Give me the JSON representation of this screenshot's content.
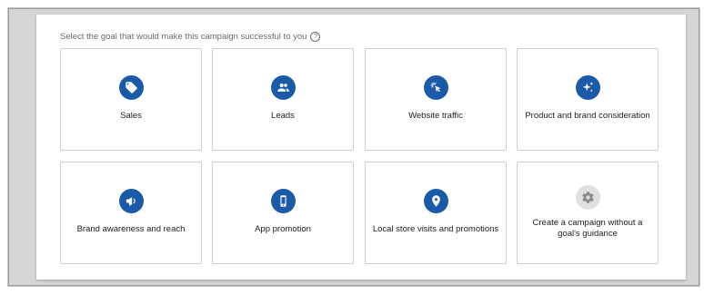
{
  "prompt": {
    "text": "Select the goal that would make this campaign successful to you",
    "help_glyph": "?"
  },
  "goals": [
    {
      "label": "Sales",
      "icon": "tag-icon"
    },
    {
      "label": "Leads",
      "icon": "people-icon"
    },
    {
      "label": "Website traffic",
      "icon": "cursor-click-icon"
    },
    {
      "label": "Product and brand consideration",
      "icon": "sparkle-icon"
    },
    {
      "label": "Brand awareness and reach",
      "icon": "megaphone-icon"
    },
    {
      "label": "App promotion",
      "icon": "phone-icon"
    },
    {
      "label": "Local store visits and promotions",
      "icon": "location-pin-icon"
    },
    {
      "label": "Create a campaign without a goal's guidance",
      "icon": "gear-icon"
    }
  ],
  "colors": {
    "icon_blue": "#1a5aa8",
    "icon_gray_bg": "#e0e0e0",
    "icon_gray_fg": "#8a8a8a",
    "card_border": "#cfcfcf"
  }
}
